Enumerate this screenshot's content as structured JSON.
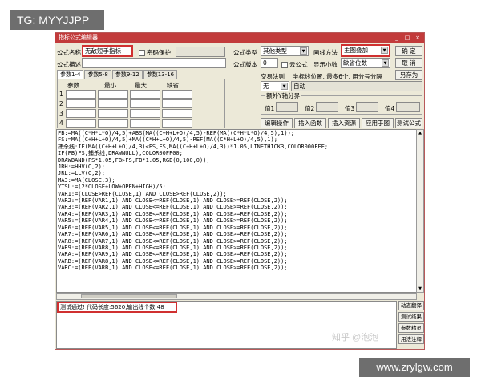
{
  "badge": "TG: MYYJJPP",
  "window": {
    "title": "指标公式编辑器",
    "controls": [
      "_",
      "□",
      "×"
    ]
  },
  "form": {
    "name_label": "公式名称",
    "name_value": "无敌短手指标",
    "password_label": "密码保护",
    "desc_label": "公式描述",
    "type_label": "公式类型",
    "type_value": "其他类型",
    "draw_label": "画线方法",
    "draw_value": "主图叠加",
    "version_label": "公式版本",
    "version_value": "0",
    "cloud_label": "云公式",
    "decimal_label": "显示小数",
    "decimal_value": "缺省位数",
    "ok": "确 定",
    "cancel": "取 消",
    "save_as": "另存为",
    "trade_rule": "交易法则",
    "coord_label": "坐标线位置, 最多6个, 用分号分隔",
    "trade_value": "无",
    "coord_value": "自动",
    "extra_axis": "额外Y轴分界",
    "values": [
      "值1",
      "值2",
      "值3",
      "值4"
    ],
    "edit_op": "编辑操作",
    "insert_func": "插入函数",
    "insert_res": "插入资源",
    "apply": "应用于图",
    "test": "测试公式"
  },
  "param_tabs": [
    "参数1-4",
    "参数5-8",
    "参数9-12",
    "参数13-16"
  ],
  "param_headers": [
    "参数",
    "最小",
    "最大",
    "缺省"
  ],
  "param_rows": [
    "1",
    "2",
    "3",
    "4"
  ],
  "code": [
    "FB:=MA((C*H*L*O)/4,5)+ABS(MA((C+H+L+O)/4,5)-REF(MA((C*H*L*O)/4,5),1));",
    "FS:=MA((C+H+L+O)/4,5)+MA((C*H+L+O)/4,5)-REF(MA((C*H+L+O)/4,5),1);",
    "捕杀线:IF(MA((C+H+L+O)/4,3)<FS,FS,MA((C+H+L+O)/4,3))*1.05,LINETHICK3,COLOR000FFF;",
    "IF(FB)FS,捕杀线,DRAWNULL),COLOR00FF00;",
    "DRAWBAND(FS*1.05,FB>FS,FB*1.05,RGB(0,100,0));",
    "JRH:=HHV(C,2);",
    "JRL:=LLV(C,2);",
    "MA3:=MA(CLOSE,3);",
    "YTSL:=(2*CLOSE+LOW+OPEN+HIGH)/5;",
    "VAR1:=(CLOSE>REF(CLOSE,1) AND CLOSE>REF(CLOSE,2));",
    "VAR2:=(REF(VAR1,1) AND CLOSE<=REF(CLOSE,1) AND CLOSE>=REF(CLOSE,2));",
    "VAR3:=(REF(VAR2,1) AND CLOSE<=REF(CLOSE,1) AND CLOSE>=REF(CLOSE,2));",
    "VAR4:=(REF(VAR3,1) AND CLOSE<=REF(CLOSE,1) AND CLOSE>=REF(CLOSE,2));",
    "VAR5:=(REF(VAR4,1) AND CLOSE<=REF(CLOSE,1) AND CLOSE>=REF(CLOSE,2));",
    "VAR6:=(REF(VAR5,1) AND CLOSE<=REF(CLOSE,1) AND CLOSE>=REF(CLOSE,2));",
    "VAR7:=(REF(VAR6,1) AND CLOSE<=REF(CLOSE,1) AND CLOSE>=REF(CLOSE,2));",
    "VAR8:=(REF(VAR7,1) AND CLOSE<=REF(CLOSE,1) AND CLOSE>=REF(CLOSE,2));",
    "VAR9:=(REF(VAR8,1) AND CLOSE<=REF(CLOSE,1) AND CLOSE>=REF(CLOSE,2));",
    "VARA:=(REF(VAR9,1) AND CLOSE<=REF(CLOSE,1) AND CLOSE>=REF(CLOSE,2));",
    "VARB:=(REF(VAR8,1) AND CLOSE<=REF(CLOSE,1) AND CLOSE>=REF(CLOSE,2));",
    "VARC:=(REF(VARB,1) AND CLOSE<=REF(CLOSE,1) AND CLOSE>=REF(CLOSE,2));"
  ],
  "status": "测试通过! 代码长度:5620,输出线个数:48",
  "side_buttons": [
    "动态翻译",
    "测试结果",
    "参数精灵",
    "用法注释"
  ],
  "watermark": "知乎 @泡泡",
  "site_badge": "www.zrylgw.com"
}
